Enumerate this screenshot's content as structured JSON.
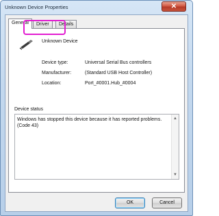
{
  "window": {
    "title": "Unknown Device Properties",
    "close_glyph": "✕"
  },
  "tabs": [
    {
      "label": "General"
    },
    {
      "label": "Driver"
    },
    {
      "label": "Details"
    }
  ],
  "device": {
    "name": "Unknown Device",
    "icon": "usb-device-icon",
    "properties": [
      {
        "label": "Device type:",
        "value": "Universal Serial Bus controllers"
      },
      {
        "label": "Manufacturer:",
        "value": "(Standard USB Host Controller)"
      },
      {
        "label": "Location:",
        "value": "Port_#0001.Hub_#0004"
      }
    ]
  },
  "status": {
    "group_label": "Device status",
    "text": "Windows has stopped this device because it has reported problems. (Code 43)",
    "scroll_up_glyph": "▲",
    "scroll_down_glyph": "▼"
  },
  "buttons": {
    "ok": "OK",
    "cancel": "Cancel"
  },
  "colors": {
    "highlight": "#e21bd0",
    "close_button": "#c9533b"
  }
}
